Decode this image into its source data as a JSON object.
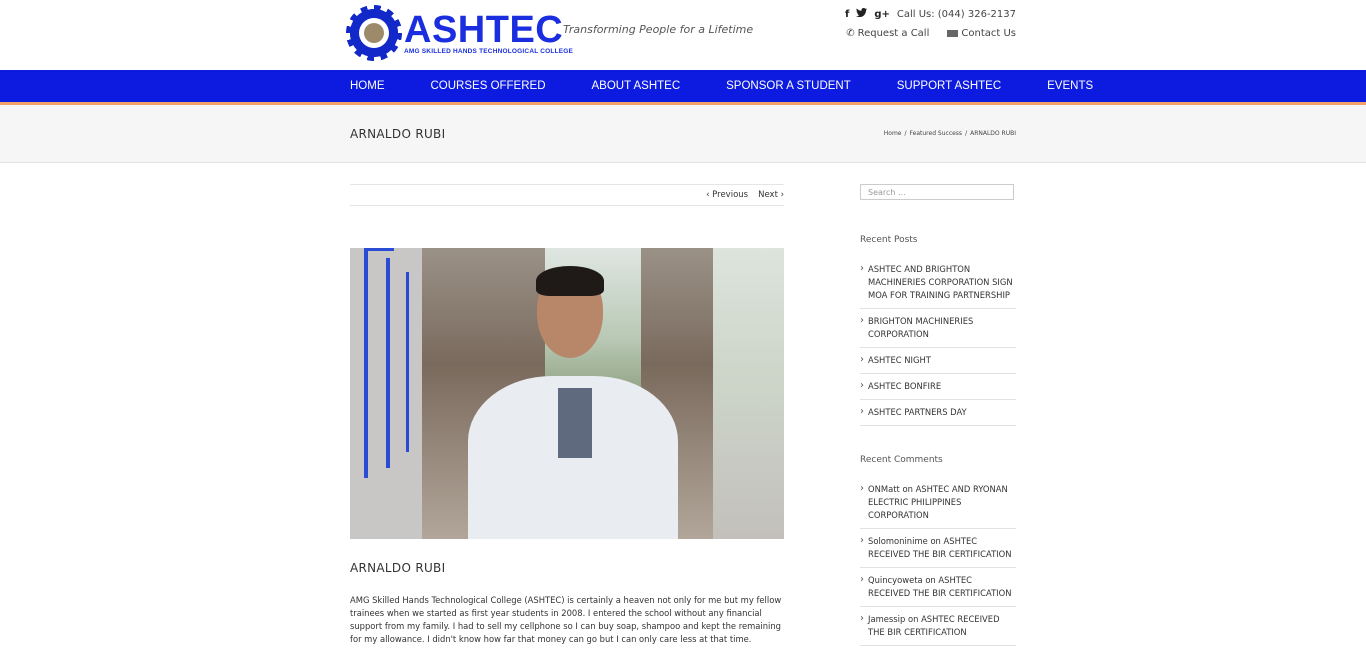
{
  "header": {
    "logo_main": "ASHTEC",
    "logo_sub": "AMG SKILLED HANDS TECHNOLOGICAL COLLEGE",
    "tagline": "Transforming People for a Lifetime",
    "call_label": "Call Us: (044) 326-2137",
    "request_call": "Request a Call",
    "contact_us": "Contact Us",
    "social": {
      "facebook": "f",
      "twitter": "t",
      "gplus": "g+"
    }
  },
  "nav": {
    "items": [
      "HOME",
      "COURSES OFFERED",
      "ABOUT ASHTEC",
      "SPONSOR A STUDENT",
      "SUPPORT ASHTEC",
      "EVENTS"
    ]
  },
  "titlebar": {
    "title": "ARNALDO RUBI",
    "breadcrumb": [
      "Home",
      "/",
      "Featured Success",
      "/",
      "ARNALDO RUBI"
    ]
  },
  "post": {
    "prev": "‹ Previous",
    "next": "Next ›",
    "title": "ARNALDO RUBI",
    "body": "AMG Skilled Hands Technological College (ASHTEC) is certainly a heaven not only for me but my fellow trainees when we started as first year students in 2008. I entered the school without any financial support from my family. I had to sell my cellphone so I can buy soap, shampoo and kept the remaining for my allowance. I didn't know how far that money can go but I can only care less at that time."
  },
  "sidebar": {
    "search_placeholder": "Search ...",
    "recent_posts_title": "Recent Posts",
    "recent_posts": [
      "ASHTEC AND BRIGHTON MACHINERIES CORPORATION SIGN MOA FOR TRAINING PARTNERSHIP",
      "BRIGHTON MACHINERIES CORPORATION",
      "ASHTEC NIGHT",
      "ASHTEC BONFIRE",
      "ASHTEC PARTNERS DAY"
    ],
    "recent_comments_title": "Recent Comments",
    "recent_comments": [
      {
        "author": "ONMatt",
        "on": "on",
        "post": "ASHTEC AND RYONAN ELECTRIC PHILIPPINES CORPORATION"
      },
      {
        "author": "Solomoninime",
        "on": "on",
        "post": "ASHTEC RECEIVED THE BIR CERTIFICATION"
      },
      {
        "author": "Quincyoweta",
        "on": "on",
        "post": "ASHTEC RECEIVED THE BIR CERTIFICATION"
      },
      {
        "author": "Jamessip",
        "on": "on",
        "post": "ASHTEC RECEIVED THE BIR CERTIFICATION"
      }
    ]
  }
}
